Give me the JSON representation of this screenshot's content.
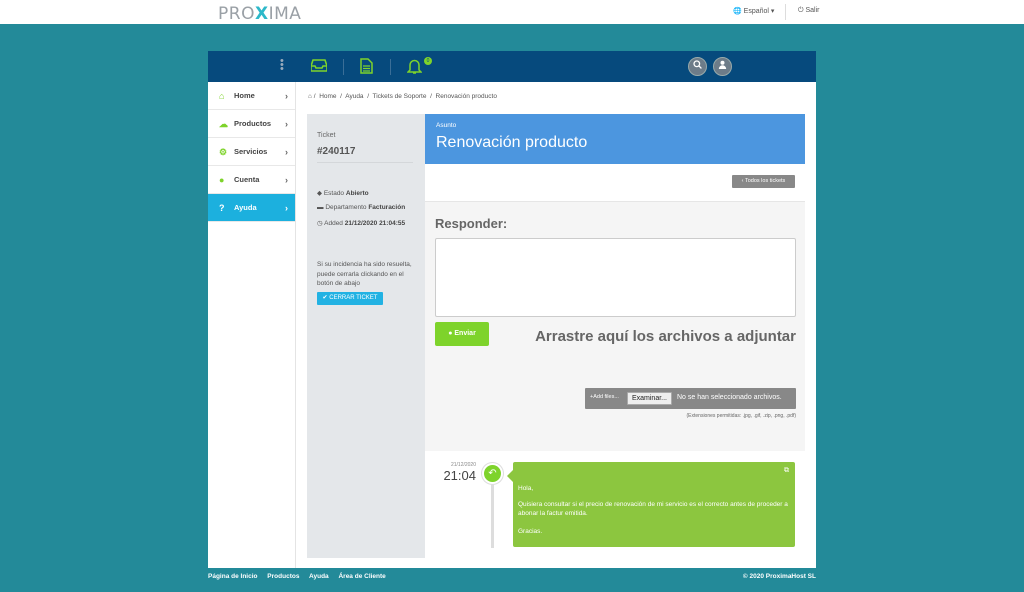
{
  "header": {
    "logo_left": "PRO",
    "logo_x": "X",
    "logo_right": "IMA",
    "language": "Español",
    "logout": "Salir"
  },
  "navbar": {
    "notification_count": "0",
    "icons": [
      "more-vertical-icon",
      "inbox-icon",
      "document-icon",
      "bell-icon",
      "search-icon",
      "user-icon"
    ]
  },
  "sidebar": {
    "items": [
      {
        "label": "Home",
        "icon": "home-icon"
      },
      {
        "label": "Productos",
        "icon": "cloud-icon"
      },
      {
        "label": "Servicios",
        "icon": "gear-icon"
      },
      {
        "label": "Cuenta",
        "icon": "user-icon"
      },
      {
        "label": "Ayuda",
        "icon": "help-icon",
        "active": true
      }
    ]
  },
  "breadcrumb": {
    "items": [
      "Home",
      "Ayuda",
      "Tickets de Soporte",
      "Renovación producto"
    ],
    "separator": "/"
  },
  "ticket": {
    "label": "Ticket",
    "number": "#240117",
    "status_label": "Estado",
    "status_value": "Abierto",
    "department_label": "Departamento",
    "department_value": "Facturación",
    "added_label": "Added",
    "added_value": "21/12/2020 21:04:55",
    "help_text": "Si su incidencia ha sido resuelta, puede cerrarla clickando en el botón de abajo",
    "close_button": "CERRAR TICKET"
  },
  "subject": {
    "label": "Asunto",
    "title": "Renovación producto",
    "all_tickets_button": "Todos los tickets"
  },
  "reply": {
    "title": "Responder:",
    "textarea_value": "",
    "send_button": "Enviar",
    "drop_text": "Arrastre aquí los archivos a adjuntar",
    "add_files": "Add files...",
    "browse_button": "Examinar...",
    "no_file": "No se han seleccionado archivos.",
    "extensions": "(Extensiones permitidas: .jpg, .gif, .zip, .png, .pdf)"
  },
  "timeline": {
    "date": "21/12/2020",
    "time": "21:04",
    "message": {
      "greeting": "Hola,",
      "body": "Quisiera consultar si el precio de renovación de mi servicio es el correcto antes de proceder a abonar la factur emitida.",
      "closing": "Gracias."
    }
  },
  "footer": {
    "links": [
      "Página de Inicio",
      "Productos",
      "Ayuda",
      "Área de Cliente"
    ],
    "copyright": "© 2020 ProximaHost SL"
  },
  "colors": {
    "background": "#238a99",
    "navbar": "#064a7d",
    "accent_green": "#7ed32b",
    "active_blue": "#1cb0de",
    "subject_blue": "#4c96df",
    "message_green": "#8cc63f"
  }
}
